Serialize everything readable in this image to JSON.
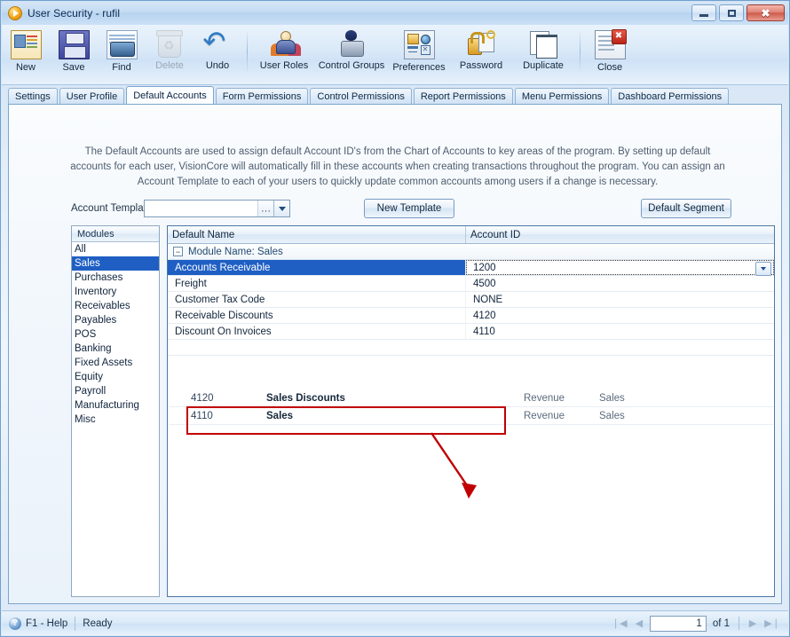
{
  "window": {
    "title": "User Security - rufil",
    "app_icon": "play-circle-icon",
    "controls": {
      "minimize": "minimize-icon",
      "maximize": "maximize-icon",
      "close": "close-icon"
    }
  },
  "toolbar": {
    "items": [
      {
        "label": "New",
        "icon": "new-record-icon",
        "disabled": false
      },
      {
        "label": "Save",
        "icon": "save-floppy-icon",
        "disabled": false
      },
      {
        "label": "Find",
        "icon": "find-binoculars-icon",
        "disabled": false
      },
      {
        "label": "Delete",
        "icon": "delete-trash-icon",
        "disabled": true
      },
      {
        "label": "Undo",
        "icon": "undo-arrow-icon",
        "disabled": false
      },
      {
        "label": "User Roles",
        "icon": "user-roles-icon",
        "disabled": false
      },
      {
        "label": "Control Groups",
        "icon": "control-groups-icon",
        "disabled": false
      },
      {
        "label": "Preferences",
        "icon": "preferences-icon",
        "disabled": false
      },
      {
        "label": "Password",
        "icon": "password-lock-icon",
        "disabled": false
      },
      {
        "label": "Duplicate",
        "icon": "duplicate-icon",
        "disabled": false
      },
      {
        "label": "Close",
        "icon": "close-document-icon",
        "disabled": false
      }
    ]
  },
  "tabs": [
    {
      "label": "Settings",
      "active": false
    },
    {
      "label": "User Profile",
      "active": false
    },
    {
      "label": "Default Accounts",
      "active": true
    },
    {
      "label": "Form Permissions",
      "active": false
    },
    {
      "label": "Control Permissions",
      "active": false
    },
    {
      "label": "Report Permissions",
      "active": false
    },
    {
      "label": "Menu Permissions",
      "active": false
    },
    {
      "label": "Dashboard Permissions",
      "active": false
    }
  ],
  "description": "The Default Accounts are used to assign default Account ID's from the Chart of Accounts to key areas of the program.  By setting up default accounts for each user, VisionCore will automatically fill in these accounts when creating transactions throughout the program.  You can assign an Account Template to each of your users to quickly update common accounts among users if a change is necessary.",
  "template_row": {
    "label": "Account Template",
    "combo_value": "",
    "combo_placeholder": "",
    "ellipsis": "···",
    "new_template_button": "New Template",
    "default_segment_button": "Default Segment"
  },
  "modules": {
    "header": "Modules",
    "selected": "Sales",
    "items": [
      "All",
      "Sales",
      "Purchases",
      "Inventory",
      "Receivables",
      "Payables",
      "POS",
      "Banking",
      "Fixed Assets",
      "Equity",
      "Payroll",
      "Manufacturing",
      "Misc"
    ]
  },
  "grid": {
    "columns": [
      "Default Name",
      "Account ID"
    ],
    "group_label": "Module Name: Sales",
    "group_expander": "−",
    "rows": [
      {
        "name": "Accounts Receivable",
        "account_id": "1200",
        "selected": true,
        "editing": true
      },
      {
        "name": "Freight",
        "account_id": "4500",
        "selected": false,
        "editing": false
      },
      {
        "name": "Customer Tax Code",
        "account_id": "NONE",
        "selected": false,
        "editing": false
      },
      {
        "name": "Receivable Discounts",
        "account_id": "4120",
        "selected": false,
        "editing": false
      },
      {
        "name": "Discount On Invoices",
        "account_id": "4110",
        "selected": false,
        "editing": false
      }
    ]
  },
  "account_lookup": {
    "rows": [
      {
        "id": "4120",
        "name": "Sales Discounts",
        "type": "Revenue",
        "module": "Sales"
      },
      {
        "id": "4110",
        "name": "Sales",
        "type": "Revenue",
        "module": "Sales"
      }
    ]
  },
  "annotation": {
    "color": "#c00000",
    "highlight_rows": [
      "Receivable Discounts",
      "Discount On Invoices"
    ],
    "arrow": "red-down-arrow"
  },
  "statusbar": {
    "help_icon": "help-question-icon",
    "help_label": "F1 - Help",
    "status": "Ready",
    "nav": {
      "first": "❘◀",
      "prev": "◀",
      "page": "1",
      "of": "of 1",
      "next": "▶",
      "last": "▶❘"
    }
  }
}
